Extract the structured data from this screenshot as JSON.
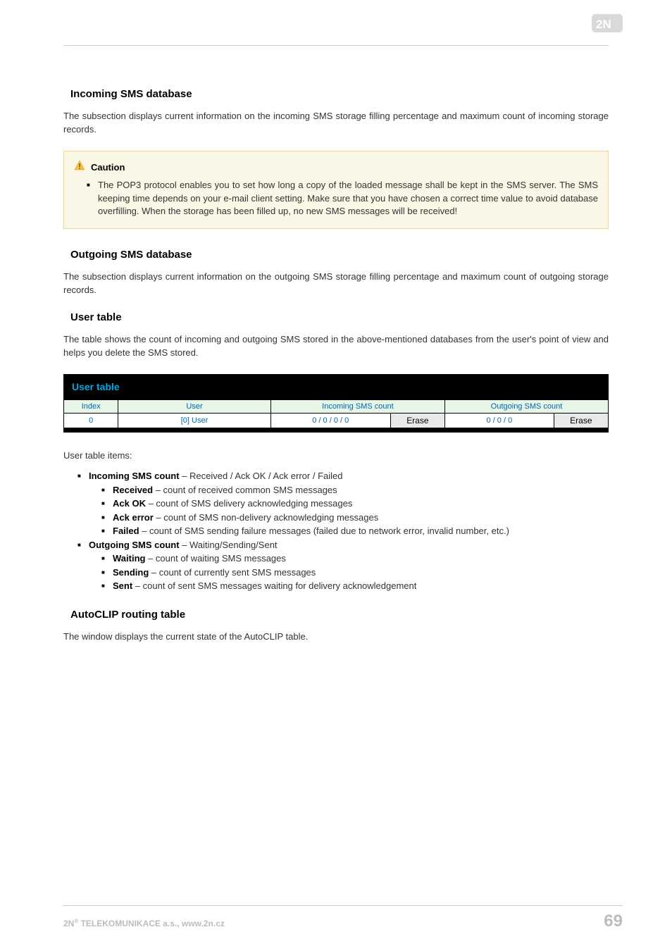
{
  "header": {
    "logo_alt": "2N"
  },
  "sections": {
    "incoming": {
      "title": "Incoming SMS database",
      "body": "The subsection displays current information on the incoming SMS storage filling percentage and maximum count of incoming storage records."
    },
    "caution": {
      "title": "Caution",
      "body": "The POP3 protocol enables you to set how long a copy of the loaded message shall be kept in the SMS server. The SMS keeping time depends on your e-mail client setting. Make sure that you have chosen a correct time value to avoid database overfilling. When the storage has been filled up, no new SMS messages will be received!"
    },
    "outgoing": {
      "title": "Outgoing SMS database",
      "body": "The subsection displays current information on the outgoing SMS storage filling percentage and maximum count of outgoing storage records."
    },
    "usertable_intro": {
      "title": "User table",
      "body": "The table shows the count of incoming and outgoing SMS stored in the above-mentioned databases from the user's point of view and helps you delete the SMS stored."
    },
    "usertable": {
      "bar_title": "User table",
      "headers": {
        "index": "Index",
        "user": "User",
        "incoming": "Incoming SMS count",
        "outgoing": "Outgoing SMS count"
      },
      "rows": [
        {
          "index": "0",
          "user": "[0] User",
          "incoming": "0 / 0 / 0 / 0",
          "erase1": "Erase",
          "outgoing": "0 / 0 / 0",
          "erase2": "Erase"
        }
      ]
    },
    "usertable_items_intro": "User table items:",
    "items": {
      "incoming_label": "Incoming SMS count",
      "incoming_suffix": " – Received / Ack OK / Ack error / Failed",
      "received_label": "Received",
      "received_suffix": " – count of received common SMS messages",
      "ackok_label": "Ack OK",
      "ackok_suffix": " – count of SMS delivery acknowledging messages",
      "ackerr_label": "Ack error",
      "ackerr_suffix": " – count of SMS non-delivery acknowledging messages",
      "failed_label": "Failed",
      "failed_suffix": " – count of SMS sending failure messages (failed due to network error, invalid number, etc.)",
      "outgoing_label": "Outgoing SMS count",
      "outgoing_suffix": "  – Waiting/Sending/Sent",
      "waiting_label": "Waiting",
      "waiting_suffix": " – count of waiting SMS messages",
      "sending_label": "Sending",
      "sending_suffix": " – count of currently sent SMS messages",
      "sent_label": "Sent",
      "sent_suffix": " – count of sent SMS messages waiting for delivery acknowledgement"
    },
    "autoclip": {
      "title": "AutoCLIP routing table",
      "body": "The window displays the current state of the AutoCLIP table."
    }
  },
  "footer": {
    "left_prefix": "2N",
    "left_sup": "®",
    "left_rest": " TELEKOMUNIKACE a.s., www.2n.cz",
    "page": "69"
  }
}
